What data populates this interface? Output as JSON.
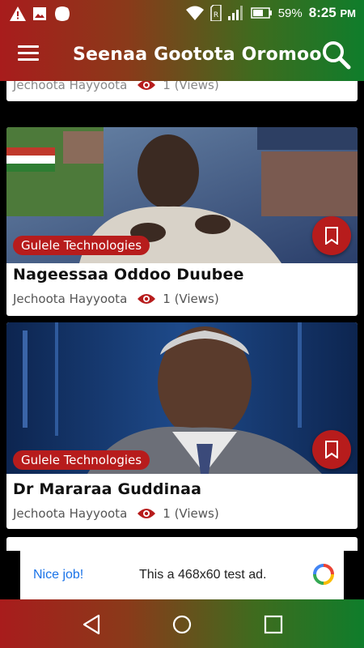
{
  "status": {
    "battery": "59%",
    "time": "8:25",
    "ampm": "PM"
  },
  "appbar": {
    "title": "Seenaa Gootota Oromoo"
  },
  "partial_card": {
    "author": "Jechoota Hayyoota",
    "views": "1 (Views)"
  },
  "cards": [
    {
      "tag": "Gulele Technologies",
      "title": "Nageessaa Oddoo Duubee",
      "author": "Jechoota Hayyoota",
      "views": "1 (Views)"
    },
    {
      "tag": "Gulele Technologies",
      "title": "Dr Mararaa Guddinaa",
      "author": "Jechoota Hayyoota",
      "views": "1 (Views)"
    }
  ],
  "ad": {
    "nice": "Nice job!",
    "text": "This a 468x60 test ad."
  },
  "colors": {
    "red": "#b71c1c",
    "green": "#0f7d2b",
    "ad_link": "#1a73e8"
  },
  "icons": [
    "warning-icon",
    "image-icon",
    "app-icon",
    "wifi-icon",
    "sim-icon",
    "signal-icon",
    "battery-icon",
    "menu-icon",
    "search-icon",
    "eye-icon",
    "bookmark-icon",
    "back-icon",
    "home-icon",
    "recents-icon"
  ]
}
